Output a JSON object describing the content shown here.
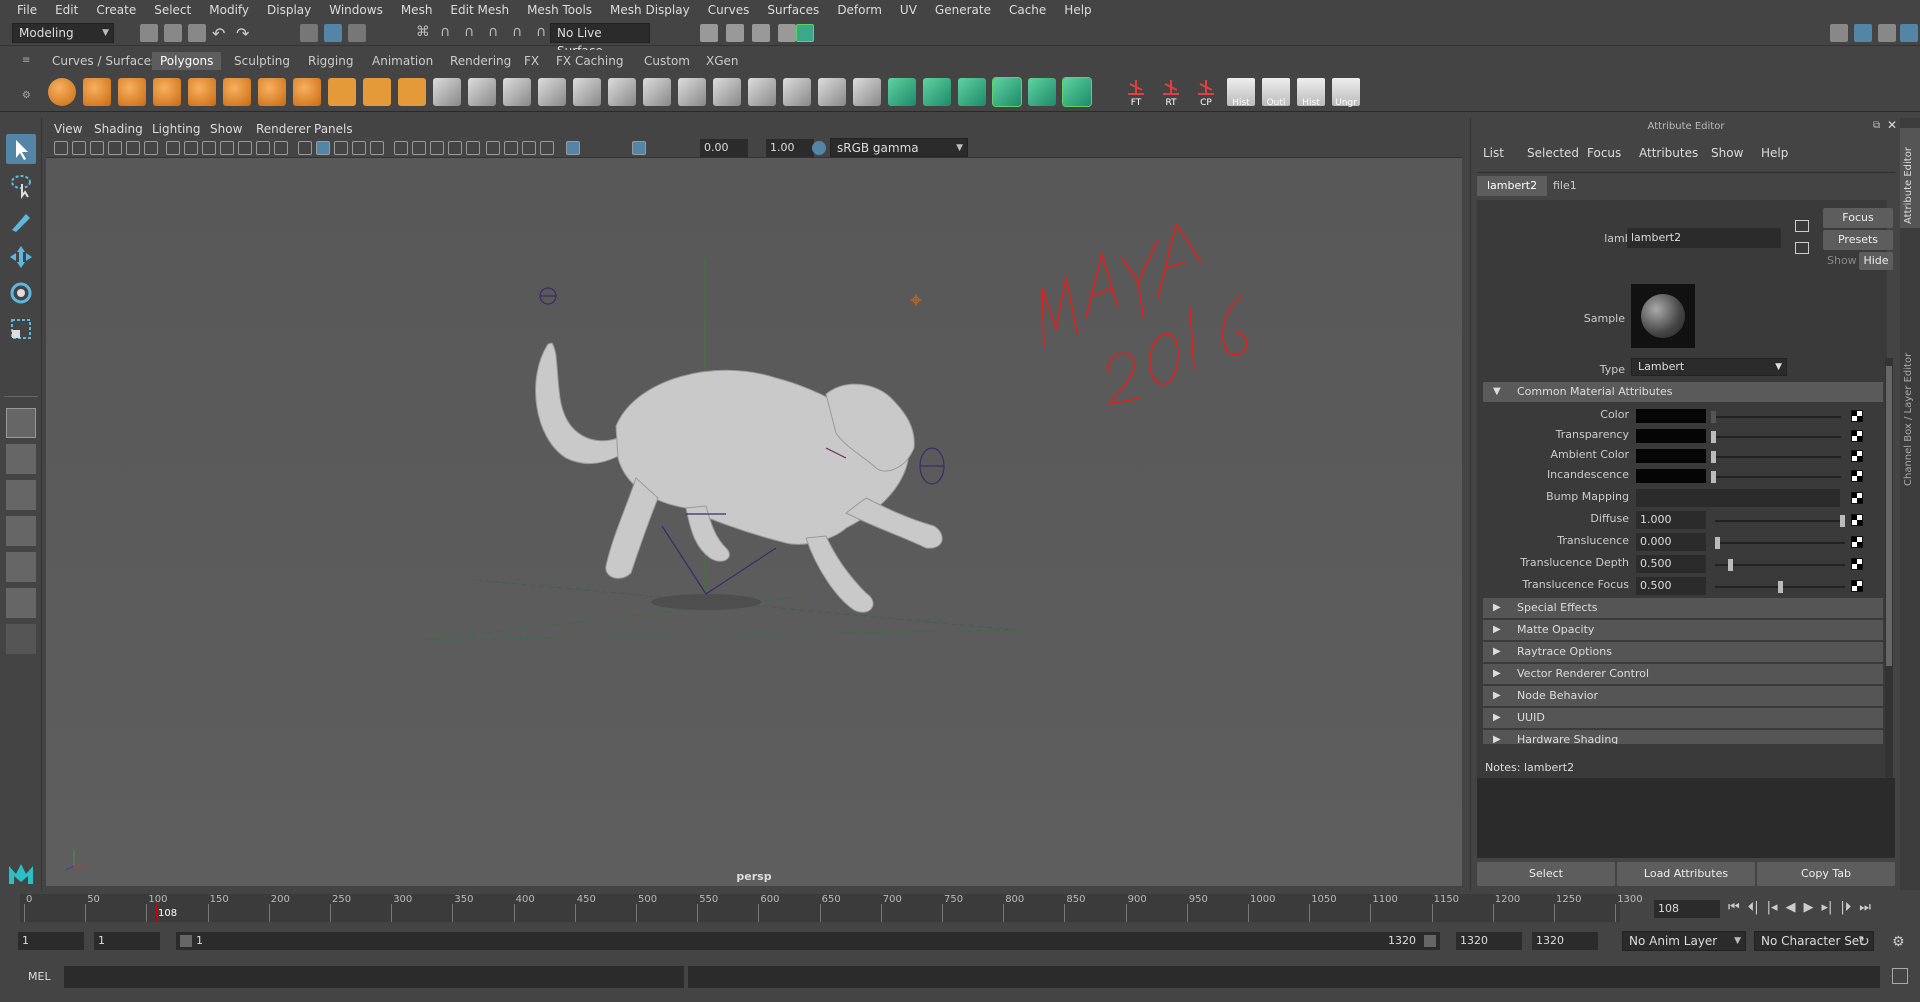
{
  "menubar": [
    "File",
    "Edit",
    "Create",
    "Select",
    "Modify",
    "Display",
    "Windows",
    "Mesh",
    "Edit Mesh",
    "Mesh Tools",
    "Mesh Display",
    "Curves",
    "Surfaces",
    "Deform",
    "UV",
    "Generate",
    "Cache",
    "Help"
  ],
  "status": {
    "mode": "Modeling",
    "live_surface": "No Live Surface"
  },
  "shelf": {
    "tabs": [
      "Curves / Surfaces",
      "Polygons",
      "Sculpting",
      "Rigging",
      "Animation",
      "Rendering",
      "FX",
      "FX Caching",
      "Custom",
      "XGen"
    ],
    "active_tab": "Polygons",
    "labeled_icons": [
      "FT",
      "RT",
      "CP",
      "Hist",
      "Outl",
      "Hist",
      "Ungr"
    ]
  },
  "viewport": {
    "menu": [
      "View",
      "Shading",
      "Lighting",
      "Show",
      "Renderer",
      "Panels"
    ],
    "exposure": "0.00",
    "gamma": "1.00",
    "color_space": "sRGB gamma",
    "camera": "persp",
    "annotation_line1": "MAYA",
    "annotation_line2": "2016"
  },
  "attr": {
    "title": "Attribute Editor",
    "menu": [
      "List",
      "Selected",
      "Focus",
      "Attributes",
      "Show",
      "Help"
    ],
    "tabs": [
      "lambert2",
      "file1"
    ],
    "node_label": "lambert:",
    "node_value": "lambert2",
    "focus_btn": "Focus",
    "presets_btn": "Presets",
    "show_btn": "Show",
    "hide_btn": "Hide",
    "sample_label": "Sample",
    "type_label": "Type",
    "type_value": "Lambert",
    "common_section": "Common Material Attributes",
    "rows": [
      {
        "label": "Color",
        "kind": "swatch"
      },
      {
        "label": "Transparency",
        "kind": "swatch"
      },
      {
        "label": "Ambient Color",
        "kind": "swatch"
      },
      {
        "label": "Incandescence",
        "kind": "swatch"
      },
      {
        "label": "Bump Mapping",
        "kind": "field"
      },
      {
        "label": "Diffuse",
        "kind": "number",
        "value": "1.000",
        "level": 1.0
      },
      {
        "label": "Translucence",
        "kind": "number",
        "value": "0.000",
        "level": 0.0
      },
      {
        "label": "Translucence Depth",
        "kind": "number",
        "value": "0.500",
        "level": 0.1
      },
      {
        "label": "Translucence Focus",
        "kind": "number",
        "value": "0.500",
        "level": 0.5
      }
    ],
    "sections": [
      "Special Effects",
      "Matte Opacity",
      "Raytrace Options",
      "Vector Renderer Control",
      "Node Behavior",
      "UUID",
      "Hardware Shading"
    ],
    "notes_label": "Notes:",
    "notes_value": "lambert2",
    "select_btn": "Select",
    "load_btn": "Load Attributes",
    "copy_btn": "Copy Tab",
    "side_tab1": "Attribute Editor",
    "side_tab2": "Channel Box / Layer Editor"
  },
  "timeline": {
    "ticks": [
      "0",
      "50",
      "100",
      "150",
      "200",
      "250",
      "300",
      "350",
      "400",
      "450",
      "500",
      "550",
      "600",
      "650",
      "700",
      "750",
      "800",
      "850",
      "900",
      "950",
      "1000",
      "1050",
      "1100",
      "1150",
      "1200",
      "1250",
      "1300"
    ],
    "current_marker": "108",
    "current_frame": "108"
  },
  "range": {
    "start": "1",
    "start_inner": "1",
    "slider_start": "1",
    "slider_end": "1320",
    "end_inner": "1320",
    "end": "1320",
    "anim_layer": "No Anim Layer",
    "char_set": "No Character Set"
  },
  "cmd": {
    "lang": "MEL"
  },
  "colors": {
    "accent": "#5285a6",
    "active_tab": "#5d5d5d",
    "annotation": "#e0201c",
    "selection_green": "#5fd35f"
  }
}
